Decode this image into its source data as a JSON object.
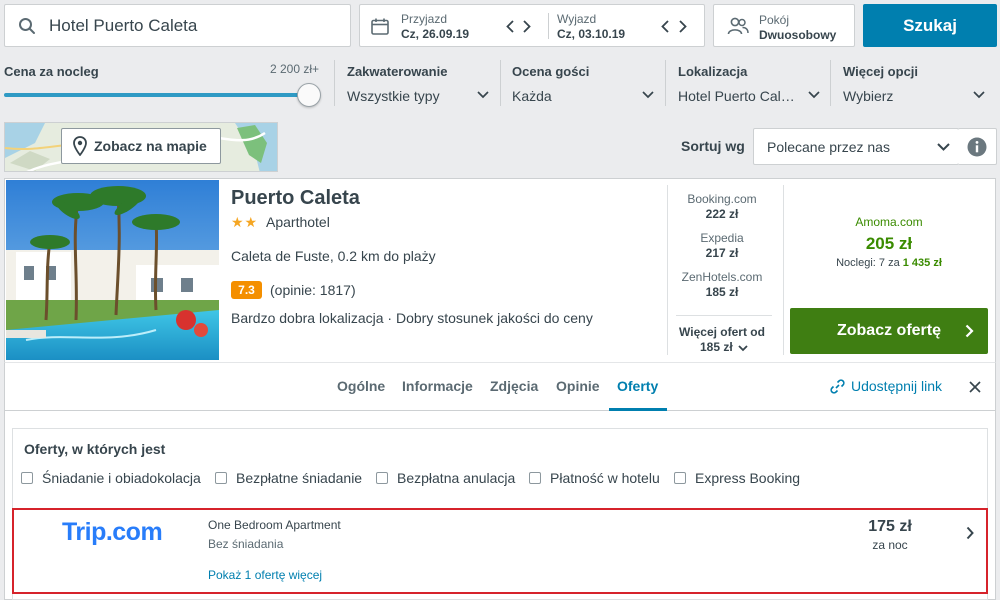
{
  "search": {
    "query": "Hotel Puerto Caleta",
    "placeholder": "",
    "checkin_label": "Przyjazd",
    "checkin_value": "Cz, 26.09.19",
    "checkout_label": "Wyjazd",
    "checkout_value": "Cz, 03.10.19",
    "room_label": "Pokój",
    "room_value": "Dwuosobowy",
    "button": "Szukaj"
  },
  "filters": {
    "price_label": "Cena za nocleg",
    "price_max": "2 200 zł+",
    "price_fraction": 1.0,
    "items": [
      {
        "label": "Zakwaterowanie",
        "value": "Wszystkie typy"
      },
      {
        "label": "Ocena gości",
        "value": "Każda"
      },
      {
        "label": "Lokalizacja",
        "value": "Hotel Puerto Cal…"
      },
      {
        "label": "Więcej opcji",
        "value": "Wybierz"
      }
    ]
  },
  "map": {
    "button": "Zobacz na mapie"
  },
  "sort": {
    "label": "Sortuj wg",
    "value": "Polecane przez nas"
  },
  "hotel": {
    "name": "Puerto Caleta",
    "stars": 2,
    "stars_text": "★★",
    "type": "Aparthotel",
    "location": "Caleta de Fuste, 0.2 km do plaży",
    "rating": "7.3",
    "reviews": "(opinie: 1817)",
    "highlights": "Bardzo dobra lokalizacja · Dobry stosunek jakości do ceny",
    "other_offers": [
      {
        "site": "Booking.com",
        "price": "222 zł"
      },
      {
        "site": "Expedia",
        "price": "217 zł"
      },
      {
        "site": "ZenHotels.com",
        "price": "185 zł"
      }
    ],
    "more_offers_label": "Więcej ofert od",
    "more_offers_price": "185 zł",
    "best": {
      "site": "Amoma.com",
      "price": "205 zł",
      "nights_prefix": "Noclegi: 7 za",
      "nights_total": "1 435 zł"
    },
    "offer_button": "Zobacz ofertę"
  },
  "tabs": {
    "items": [
      "Ogólne",
      "Informacje",
      "Zdjęcia",
      "Opinie",
      "Oferty"
    ],
    "active": "Oferty",
    "share": "Udostępnij link"
  },
  "offers": {
    "heading": "Oferty, w których jest",
    "checkboxes": [
      "Śniadanie i obiadokolacja",
      "Bezpłatne śniadanie",
      "Bezpłatna anulacja",
      "Płatność w hotelu",
      "Express Booking"
    ],
    "row": {
      "provider_logo": "Trip.com",
      "room": "One Bedroom Apartment",
      "board": "Bez śniadania",
      "more": "Pokaż 1 ofertę więcej",
      "price": "175 zł",
      "per": "za noc"
    }
  },
  "colors": {
    "primary": "#007faf",
    "offer_green": "#3f7e12",
    "price_green": "#3a8b00",
    "rating_orange": "#f48f00",
    "highlight_red": "#d6232b",
    "trip_blue": "#287dfa",
    "link_blue": "#007faf"
  },
  "icons": [
    "search-icon",
    "calendar-icon",
    "chevron-left-icon",
    "chevron-right-icon",
    "people-icon",
    "chevron-down-icon",
    "map-pin-icon",
    "info-icon",
    "link-icon",
    "close-icon"
  ]
}
